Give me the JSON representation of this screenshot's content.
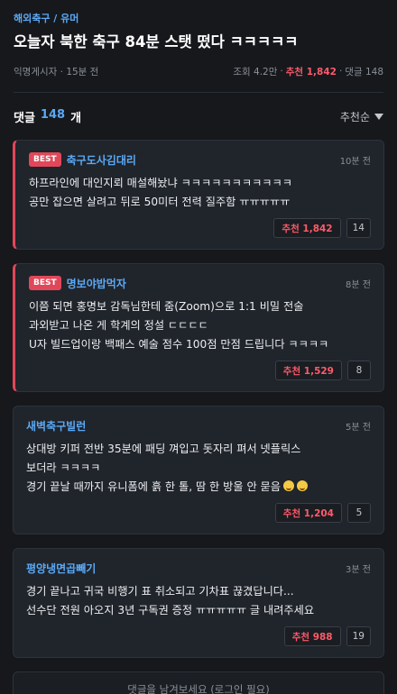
{
  "post": {
    "breadcrumb": "해외축구 / 유머",
    "title": "오늘자 북한 축구 84분 스탯 떴다 ㅋㅋㅋㅋㅋ",
    "author_time": "익명게시자 · 15분 전",
    "views": "조회 4.2만",
    "sep1": "·",
    "recommend": "추천 1,842",
    "sep2": "·",
    "comments": "댓글 148"
  },
  "comments_header": {
    "label": "댓글",
    "count": "148",
    "unit": "개",
    "sort": "추천순"
  },
  "comments": [
    {
      "badge": "BEST",
      "author": "축구도사김대리",
      "time": "10분 전",
      "lines": [
        "하프라인에 대인지뢰 매설해놨냐 ㅋㅋㅋㅋㅋㅋㅋㅋㅋㅋㅋ",
        "공만 잡으면 살려고 뒤로 50미터 전력 질주함 ㅠㅠㅠㅠㅠ"
      ],
      "recommend": "추천 1,842",
      "replies": "14"
    },
    {
      "badge": "BEST",
      "author": "명보야밥먹자",
      "time": "8분 전",
      "lines": [
        "이쯤 되면 홍명보 감독님한테 줌(Zoom)으로 1:1 비밀 전술",
        "과외받고 나온 게 학계의 정설 ㄷㄷㄷㄷ",
        "U자 빌드업이랑 백패스 예술 점수 100점 만점 드립니다 ㅋㅋㅋㅋ"
      ],
      "recommend": "추천 1,529",
      "replies": "8"
    },
    {
      "author": "새벽축구빌런",
      "time": "5분 전",
      "lines": [
        "상대방 키퍼 전반 35분에 패딩 껴입고 돗자리 펴서 넷플릭스",
        "보더라 ㅋㅋㅋㅋ",
        "경기 끝날 때까지 유니폼에 흙 한 톨, 땀 한 방울 안 묻음"
      ],
      "recommend": "추천 1,204",
      "replies": "5"
    },
    {
      "author": "평양냉면곱빼기",
      "time": "3분 전",
      "lines": [
        "경기 끝나고 귀국 비행기 표 취소되고 기차표 끊겼답니다...",
        "선수단 전원 아오지 3년 구독권 증정 ㅠㅠㅠㅠㅠ 글 내려주세요"
      ],
      "recommend": "추천 988",
      "replies": "19"
    }
  ],
  "comment_input": {
    "placeholder": "댓글을 남겨보세요 (로그인 필요)"
  },
  "colors": {
    "background": "#16181c",
    "accent": "#5aa9f5",
    "best": "#e0485a",
    "recommend": "#ff5a6a"
  }
}
